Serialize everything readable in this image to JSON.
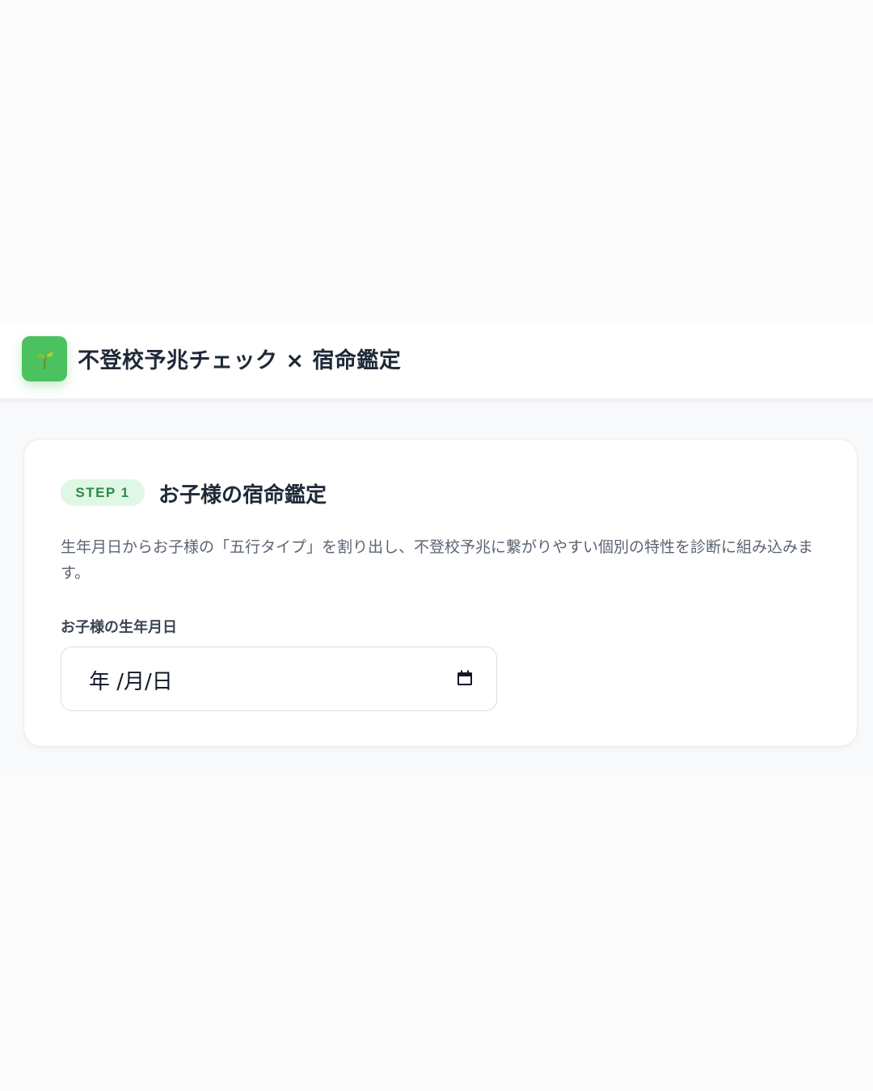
{
  "header": {
    "logo_icon": "seedling-icon",
    "title": "不登校予兆チェック × 宿命鑑定"
  },
  "step": {
    "badge": "STEP 1",
    "title": "お子様の宿命鑑定",
    "description": "生年月日からお子様の「五行タイプ」を割り出し、不登校予兆に繋がりやすい個別の特性を診断に組み込みます。",
    "field": {
      "label": "お子様の生年月日",
      "placeholder": "年 /月/日",
      "icon": "calendar-icon"
    }
  },
  "colors": {
    "accent": "#4cc160",
    "badge_bg": "#dff7e4",
    "badge_text": "#2e8b45",
    "text": "#1f2937",
    "muted_text": "#5b6472"
  }
}
